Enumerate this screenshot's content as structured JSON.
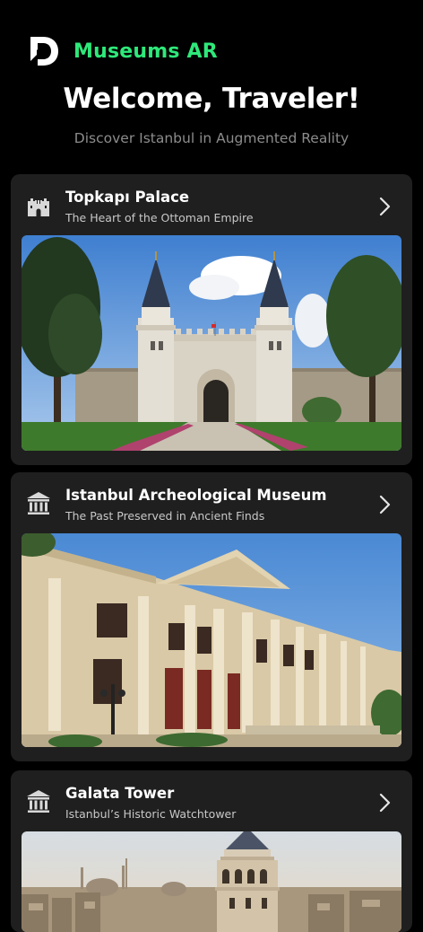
{
  "app": {
    "title": "Museums AR",
    "logo_icon": "d-logo-icon",
    "accent_color": "#2ee87a"
  },
  "welcome": {
    "heading": "Welcome, Traveler!",
    "subheading": "Discover Istanbul in Augmented Reality"
  },
  "museums": [
    {
      "title": "Topkapı Palace",
      "subtitle": "The Heart of the Ottoman Empire",
      "icon": "castle-icon",
      "action_icon": "chevron-right-icon",
      "image": "photo of Topkapı Palace gate with twin conical towers"
    },
    {
      "title": "Istanbul Archeological Museum",
      "subtitle": "The Past Preserved in Ancient Finds",
      "icon": "museum-icon",
      "action_icon": "chevron-right-icon",
      "image": "photo of neoclassical museum facade with columns"
    },
    {
      "title": "Galata Tower",
      "subtitle": "Istanbul’s Historic Watchtower",
      "icon": "museum-icon",
      "action_icon": "chevron-right-icon",
      "image": "photo of Galata Tower over the city skyline"
    }
  ]
}
